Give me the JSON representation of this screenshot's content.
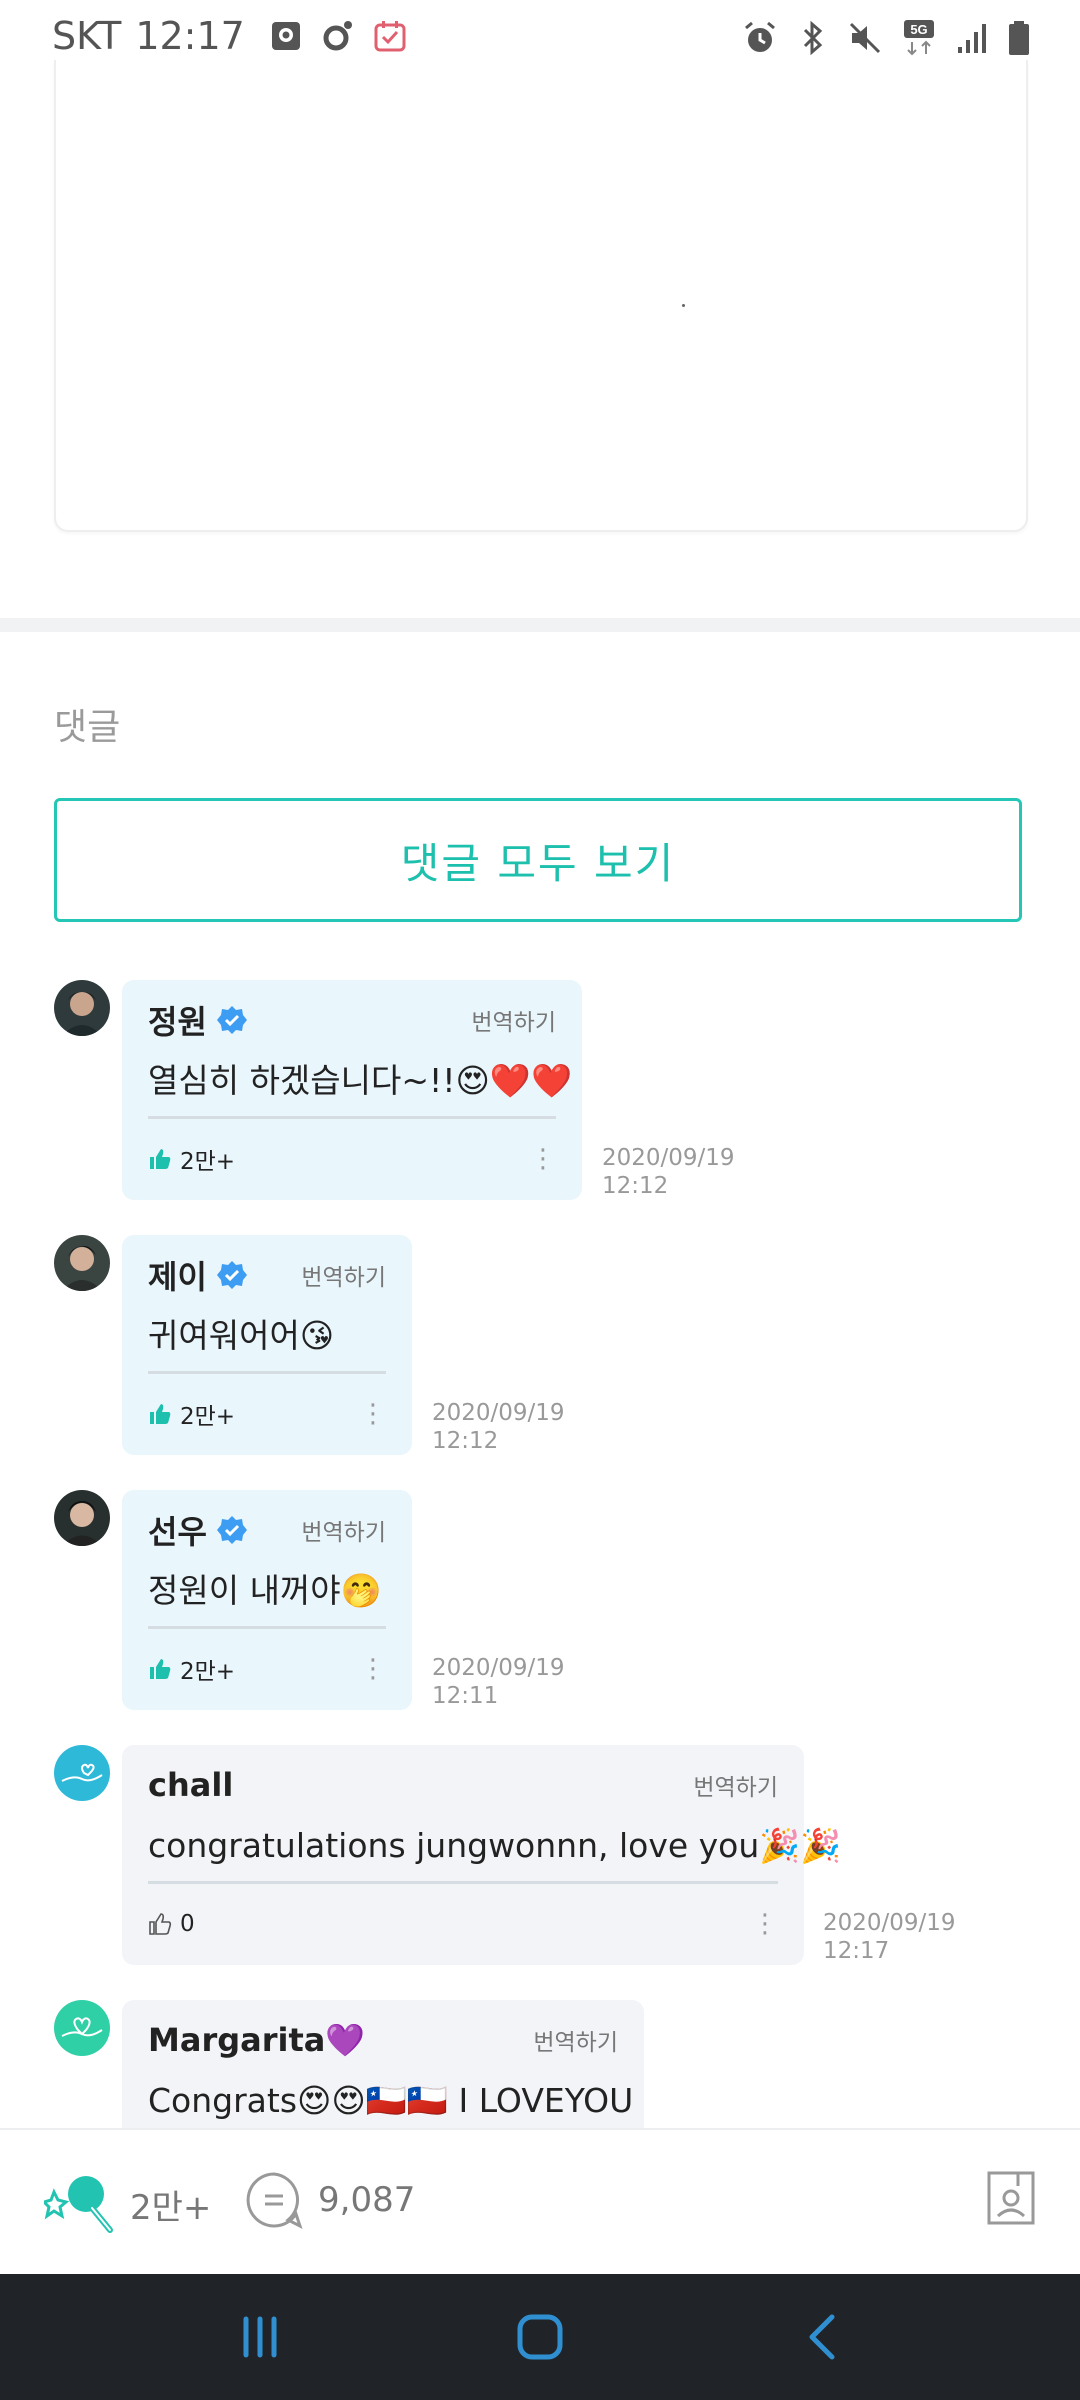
{
  "status_bar": {
    "carrier": "SKT",
    "time": "12:17",
    "left_icons": [
      "screenshot-icon",
      "dot-app-icon",
      "calendar-check-icon"
    ],
    "right_icons": [
      "alarm-icon",
      "bluetooth-icon",
      "mute-icon",
      "5g-icon",
      "signal-icon",
      "battery-icon"
    ],
    "network_label": "5G"
  },
  "comments_section": {
    "title": "댓글",
    "view_all_label": "댓글 모두 보기"
  },
  "comments": [
    {
      "author": "정원",
      "verified": true,
      "translate_label": "번역하기",
      "text": "열심히 하겠습니다~!!😍❤️❤️",
      "likes": "2만+",
      "date": "2020/09/19",
      "time": "12:12"
    },
    {
      "author": "제이",
      "verified": true,
      "translate_label": "번역하기",
      "text": "귀여워어어😘",
      "likes": "2만+",
      "date": "2020/09/19",
      "time": "12:12"
    },
    {
      "author": "선우",
      "verified": true,
      "translate_label": "번역하기",
      "text": "정원이 내꺼야🤭",
      "likes": "2만+",
      "date": "2020/09/19",
      "time": "12:11"
    },
    {
      "author": "chall",
      "verified": false,
      "translate_label": "번역하기",
      "text": "congratulations jungwonnn, love you🎉🎉",
      "likes": "0",
      "date": "2020/09/19",
      "time": "12:17"
    },
    {
      "author": "Margarita💜",
      "verified": false,
      "translate_label": "번역하기",
      "text": "Congrats😍😍🇨🇱🇨🇱 I LOVEYOU"
    }
  ],
  "action_bar": {
    "cheer_count": "2만+",
    "comment_count": "9,087"
  },
  "colors": {
    "accent": "#1dbfad",
    "artist_bubble": "#e9f6fc",
    "fan_bubble": "#f3f4f8",
    "verified_badge": "#3d9df2",
    "nav_bar": "#202428",
    "nav_icon": "#2f8fd0"
  }
}
